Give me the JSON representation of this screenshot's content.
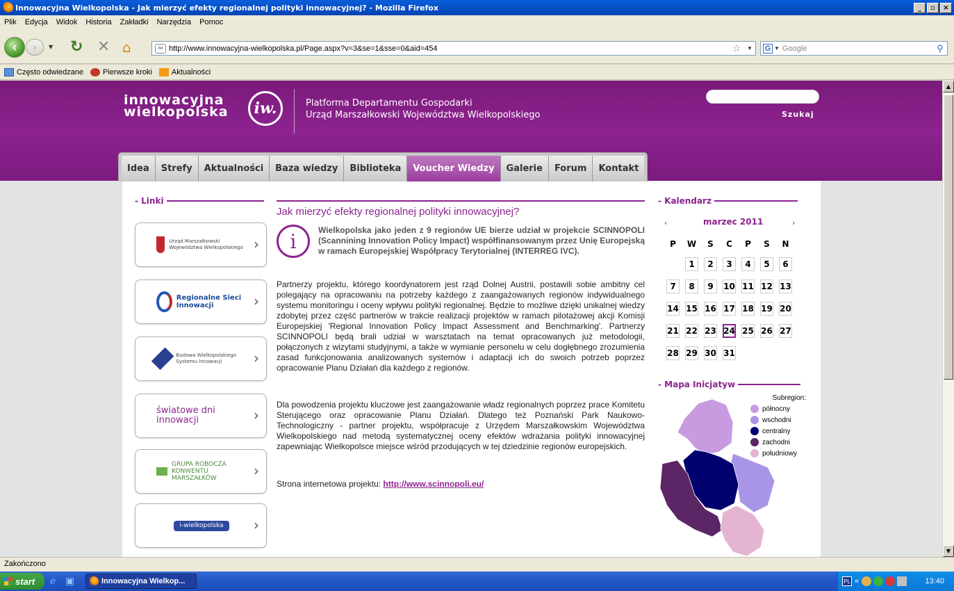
{
  "window": {
    "title": "Innowacyjna Wielkopolska - Jak mierzyć efekty regionalnej polityki innowacyjnej? - Mozilla Firefox",
    "min": "_",
    "max": "▫",
    "close": "×"
  },
  "menu": [
    "Plik",
    "Edycja",
    "Widok",
    "Historia",
    "Zakładki",
    "Narzędzia",
    "Pomoc"
  ],
  "toolbar": {
    "url": "http://www.innowacyjna-wielkopolska.pl/Page.aspx?v=3&se=1&sse=0&aid=454",
    "search_placeholder": "Google"
  },
  "bookmarks": [
    "Często odwiedzane",
    "Pierwsze kroki",
    "Aktualności"
  ],
  "header": {
    "logo_line1": "innowacyjna",
    "logo_line2": "wielkopolska",
    "logo_mark": "iw.",
    "platform_line1": "Platforma Departamentu Gospodarki",
    "platform_line2": "Urząd Marszałkowski Województwa Wielkopolskiego",
    "search_button": "Szukaj"
  },
  "tabs": [
    {
      "label": "Idea"
    },
    {
      "label": "Strefy"
    },
    {
      "label": "Aktualności"
    },
    {
      "label": "Baza wiedzy"
    },
    {
      "label": "Biblioteka"
    },
    {
      "label": "Voucher Wiedzy",
      "active": true
    },
    {
      "label": "Galerie"
    },
    {
      "label": "Forum"
    },
    {
      "label": "Kontakt"
    }
  ],
  "links": {
    "title": "- Linki",
    "items": [
      {
        "label": "Urząd Marszałkowski Województwa Wielkopolskiego"
      },
      {
        "label": "Regionalne Sieci Innowacji"
      },
      {
        "label": "Budowa Wielkopolskiego Systemu Innowacji"
      },
      {
        "label": "światowe dni innowacji"
      },
      {
        "label": "GRUPA ROBOCZA KONWENTU MARSZAŁKÓW"
      },
      {
        "label": "i-wielkopolska"
      }
    ]
  },
  "article": {
    "title": "Jak mierzyć efekty regionalnej polityki innowacyjnej?",
    "lead": "Wielkopolska jako jeden z 9 regionów UE bierze udział w projekcie SCINNOPOLI (Scannining Innovation Policy Impact) współfinansowanym przez Unię Europejską w ramach Europejskiej Współpracy Terytorialnej (INTERREG IVC).",
    "para1": "Partnerzy projektu, którego koordynatorem jest rząd Dolnej Austrii, postawili sobie ambitny cel polegający na opracowaniu na potrzeby każdego z zaangażowanych regionów indywidualnego systemu monitoringu i oceny wpływu polityki regionalnej. Będzie to możliwe dzięki unikalnej wiedzy zdobytej przez część partnerów w trakcie realizacji projektów w ramach pilotażowej akcji Komisji Europejskiej 'Regional Innovation Policy Impact Assessment and Benchmarking'. Partnerzy SCINNOPOLI będą brali udział w warsztatach na temat opracowanych już metodologii, połączonych z wizytami studyjnymi, a także w wymianie personelu w celu dogłębnego zrozumienia zasad funkcjonowania analizowanych systemów i adaptacji ich do swoich potrzeb poprzez opracowanie Planu Działań dla każdego z regionów.",
    "para2": "Dla powodzenia projektu kluczowe jest zaangażowanie władz regionalnych poprzez prace Komitetu Sterującego oraz opracowanie Planu Działań. Dlatego też Poznański Park Naukowo-Technologiczny - partner projektu, współpracuje z Urzędem Marszałkowskim Województwa Wielkopolskiego nad metodą systematycznej oceny efektów wdrażania polityki innowacyjnej zapewniając Wielkopolsce miejsce wśród przodujących w tej dziedzinie regionów europejskich.",
    "link_prefix": "Strona internetowa projektu: ",
    "link_text": "http://www.scinnopoli.eu/"
  },
  "calendar": {
    "title": "- Kalendarz",
    "month": "marzec 2011",
    "prev": "‹",
    "next": "›",
    "weekdays": [
      "P",
      "W",
      "S",
      "C",
      "P",
      "S",
      "N"
    ],
    "weeks": [
      [
        "",
        "1",
        "2",
        "3",
        "4",
        "5",
        "6"
      ],
      [
        "7",
        "8",
        "9",
        "10",
        "11",
        "12",
        "13"
      ],
      [
        "14",
        "15",
        "16",
        "17",
        "18",
        "19",
        "20"
      ],
      [
        "21",
        "22",
        "23",
        "24",
        "25",
        "26",
        "27"
      ],
      [
        "28",
        "29",
        "30",
        "31",
        "",
        "",
        ""
      ]
    ],
    "today": "24"
  },
  "map": {
    "title": "- Mapa Inicjatyw",
    "legend_title": "Subregion:",
    "legend": [
      {
        "label": "północny",
        "color": "#c89ae0"
      },
      {
        "label": "wschodni",
        "color": "#a995e8"
      },
      {
        "label": "centralny",
        "color": "#00006e"
      },
      {
        "label": "zachodni",
        "color": "#5b2566"
      },
      {
        "label": "południowy",
        "color": "#e5b4d2"
      }
    ]
  },
  "status": "Zakończono",
  "taskbar": {
    "start": "start",
    "task": "Innowacyjna Wielkop...",
    "lang": "PL",
    "clock": "13:40"
  }
}
